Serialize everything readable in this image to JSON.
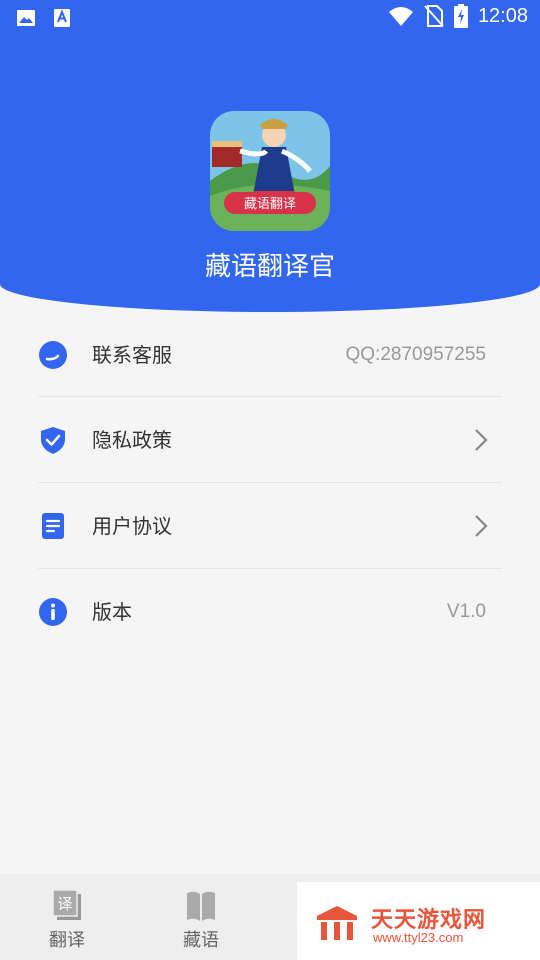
{
  "status_bar": {
    "time": "12:08",
    "icons": [
      "image-icon",
      "text-a-icon",
      "wifi-icon",
      "no-sim-icon",
      "battery-charging-icon"
    ]
  },
  "header": {
    "app_name": "藏语翻译官",
    "logo_badge": "藏语翻译",
    "accent_color": "#3366ee"
  },
  "menu": [
    {
      "icon": "customer-service-icon",
      "label": "联系客服",
      "value": "QQ:2870957255"
    },
    {
      "icon": "shield-check-icon",
      "label": "隐私政策",
      "value": ""
    },
    {
      "icon": "document-icon",
      "label": "用户协议",
      "value": ""
    },
    {
      "icon": "info-icon",
      "label": "版本",
      "value": "V1.0"
    }
  ],
  "bottom_nav": {
    "items": [
      {
        "icon": "translate-icon",
        "label": "翻译"
      },
      {
        "icon": "book-icon",
        "label": "藏语"
      }
    ]
  },
  "watermark": {
    "title": "天天游戏网",
    "url": "www.ttyl23.com"
  }
}
